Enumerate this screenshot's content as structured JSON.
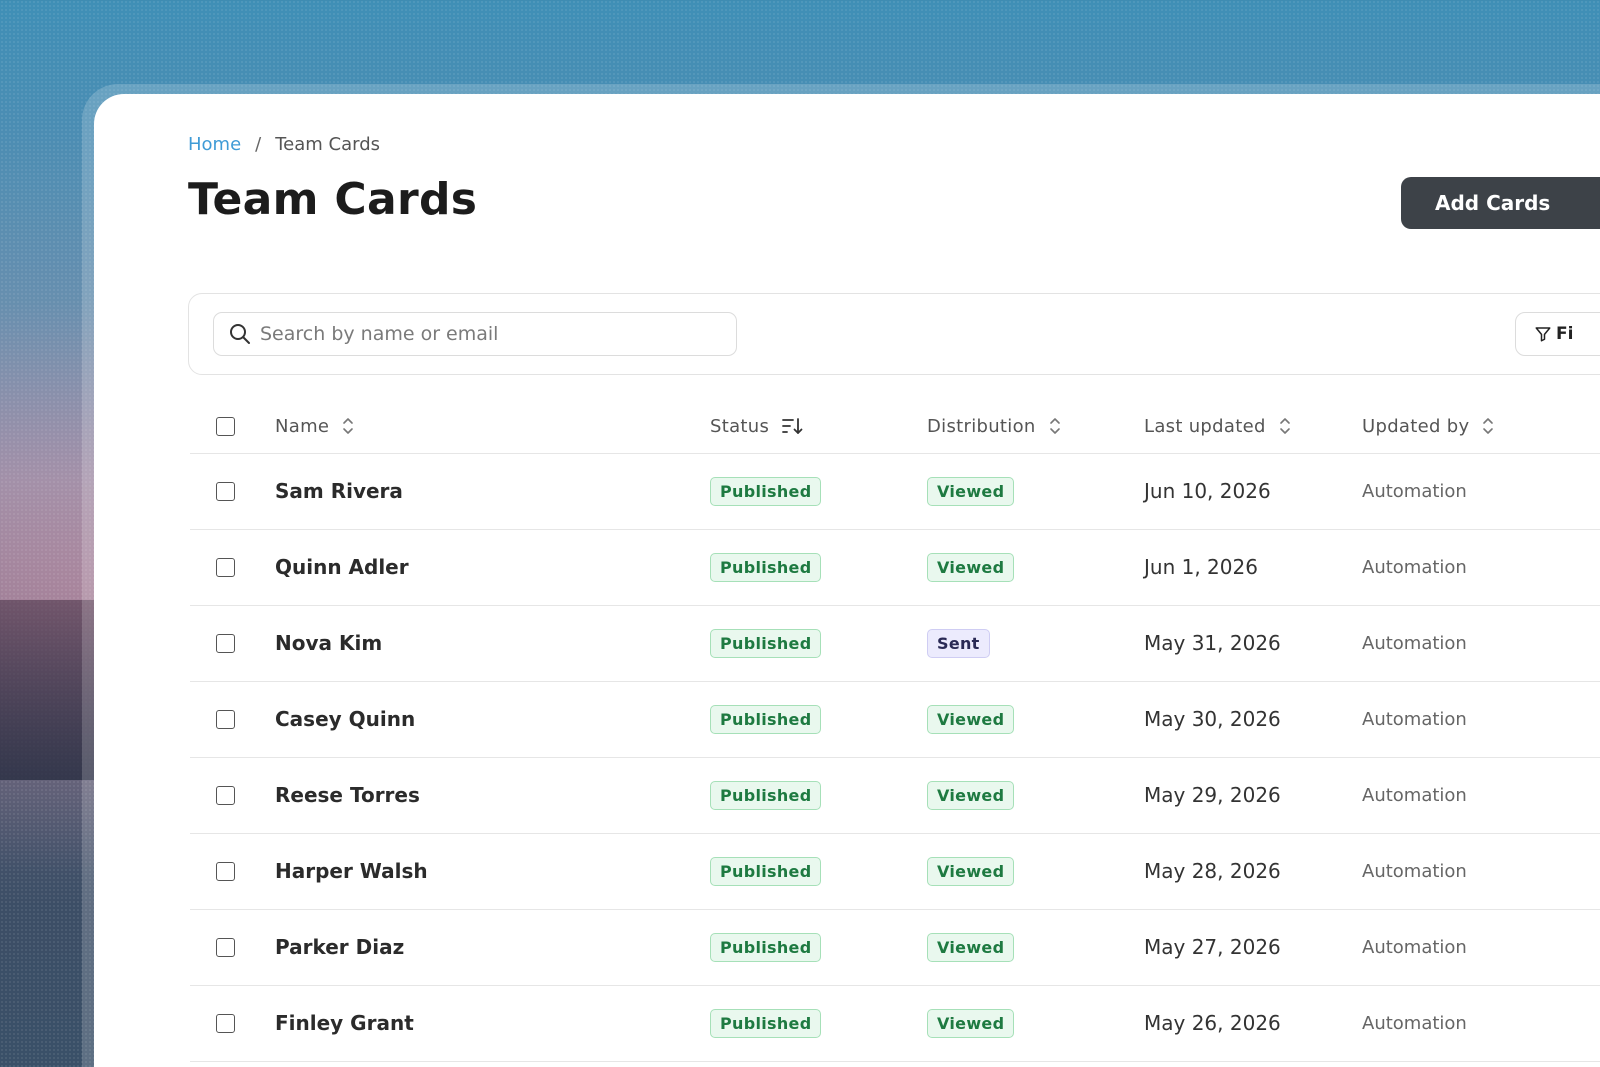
{
  "breadcrumb": {
    "home": "Home",
    "separator": "/",
    "current": "Team Cards"
  },
  "page": {
    "title": "Team Cards",
    "add_button": "Add Cards"
  },
  "search": {
    "placeholder": "Search by name or email",
    "value": ""
  },
  "filter": {
    "label": "Fi",
    "icon": "filter-icon"
  },
  "table": {
    "columns": {
      "name": "Name",
      "status": "Status",
      "distribution": "Distribution",
      "last_updated": "Last updated",
      "updated_by": "Updated by"
    },
    "rows": [
      {
        "name": "Sam Rivera",
        "status": "Published",
        "distribution": "Viewed",
        "distribution_color": "green",
        "last_updated": "Jun 10, 2026",
        "updated_by": "Automation"
      },
      {
        "name": "Quinn Adler",
        "status": "Published",
        "distribution": "Viewed",
        "distribution_color": "green",
        "last_updated": "Jun 1, 2026",
        "updated_by": "Automation"
      },
      {
        "name": "Nova Kim",
        "status": "Published",
        "distribution": "Sent",
        "distribution_color": "purple",
        "last_updated": "May 31, 2026",
        "updated_by": "Automation"
      },
      {
        "name": "Casey Quinn",
        "status": "Published",
        "distribution": "Viewed",
        "distribution_color": "green",
        "last_updated": "May 30, 2026",
        "updated_by": "Automation"
      },
      {
        "name": "Reese Torres",
        "status": "Published",
        "distribution": "Viewed",
        "distribution_color": "green",
        "last_updated": "May 29, 2026",
        "updated_by": "Automation"
      },
      {
        "name": "Harper Walsh",
        "status": "Published",
        "distribution": "Viewed",
        "distribution_color": "green",
        "last_updated": "May 28, 2026",
        "updated_by": "Automation"
      },
      {
        "name": "Parker Diaz",
        "status": "Published",
        "distribution": "Viewed",
        "distribution_color": "green",
        "last_updated": "May 27, 2026",
        "updated_by": "Automation"
      },
      {
        "name": "Finley Grant",
        "status": "Published",
        "distribution": "Viewed",
        "distribution_color": "green",
        "last_updated": "May 26, 2026",
        "updated_by": "Automation"
      }
    ]
  },
  "colors": {
    "accent_link": "#3f9bd6",
    "button_dark": "#3d4248",
    "badge_green_text": "#1e7a41",
    "badge_purple_bg": "#ecebfd"
  }
}
